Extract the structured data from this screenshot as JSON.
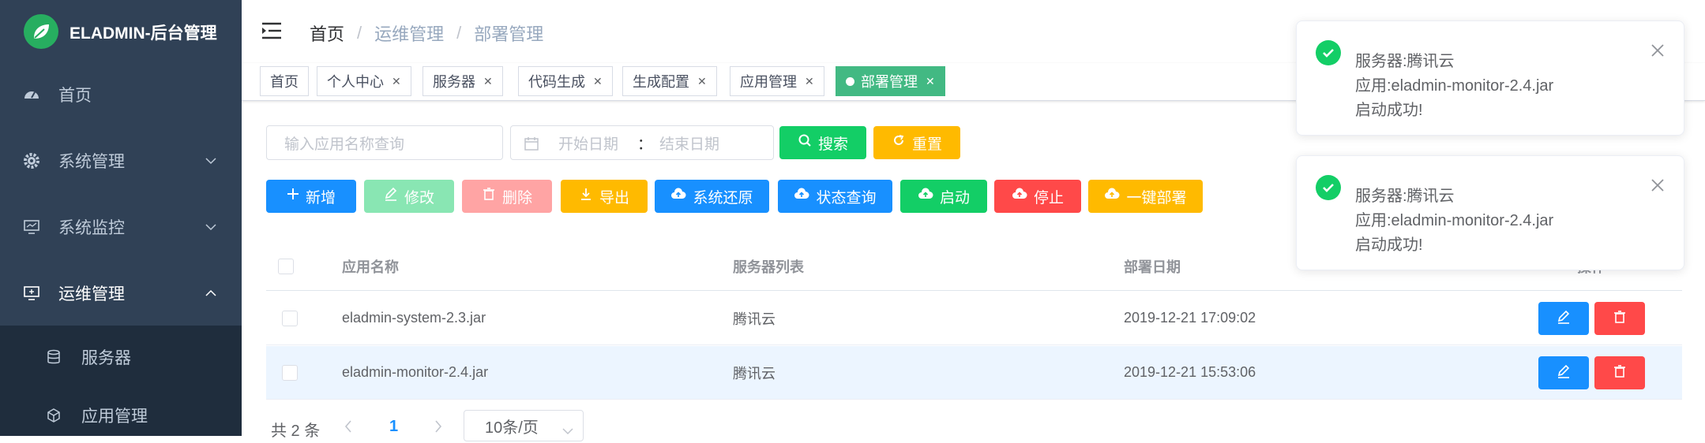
{
  "app": {
    "title": "ELADMIN-后台管理"
  },
  "sidebar": {
    "items": [
      {
        "label": "首页",
        "icon": "dashboard-icon"
      },
      {
        "label": "系统管理",
        "icon": "gear-icon"
      },
      {
        "label": "系统监控",
        "icon": "monitor-icon"
      },
      {
        "label": "运维管理",
        "icon": "server-monitor-icon"
      }
    ],
    "subitems": [
      {
        "label": "服务器",
        "icon": "database-icon"
      },
      {
        "label": "应用管理",
        "icon": "cube-icon"
      }
    ]
  },
  "breadcrumb": {
    "home": "首页",
    "level1": "运维管理",
    "level2": "部署管理",
    "separator": "/"
  },
  "tags": [
    {
      "label": "首页",
      "closable": false
    },
    {
      "label": "个人中心",
      "closable": true
    },
    {
      "label": "服务器",
      "closable": true
    },
    {
      "label": "代码生成",
      "closable": true
    },
    {
      "label": "生成配置",
      "closable": true
    },
    {
      "label": "应用管理",
      "closable": true
    },
    {
      "label": "部署管理",
      "closable": true,
      "active": true
    }
  ],
  "search": {
    "app_placeholder": "输入应用名称查询",
    "start_placeholder": "开始日期",
    "range_separator": "：",
    "end_placeholder": "结束日期",
    "search_label": "搜索",
    "reset_label": "重置"
  },
  "toolbar": {
    "add": "新增",
    "edit": "修改",
    "delete": "删除",
    "export": "导出",
    "restore": "系统还原",
    "status": "状态查询",
    "start": "启动",
    "stop": "停止",
    "deploy": "一键部署"
  },
  "table": {
    "headers": {
      "app": "应用名称",
      "servers": "服务器列表",
      "date": "部署日期",
      "ops": "操作"
    },
    "rows": [
      {
        "app": "eladmin-system-2.3.jar",
        "servers": "腾讯云",
        "date": "2019-12-21 17:09:02"
      },
      {
        "app": "eladmin-monitor-2.4.jar",
        "servers": "腾讯云",
        "date": "2019-12-21 15:53:06"
      }
    ]
  },
  "pagination": {
    "total": "共 2 条",
    "current": "1",
    "page_size": "10条/页"
  },
  "notifications": [
    {
      "line1": "服务器:腾讯云",
      "line2": "应用:eladmin-monitor-2.4.jar",
      "line3": "启动成功!"
    },
    {
      "line1": "服务器:腾讯云",
      "line2": "应用:eladmin-monitor-2.4.jar",
      "line3": "启动成功!"
    }
  ],
  "colors": {
    "sidebar": "#304156",
    "submenu": "#1f2d3d",
    "primary": "#1890ff",
    "success": "#13ce66",
    "warning": "#ffba00",
    "danger": "#ff4949",
    "tag_active": "#42b983"
  }
}
